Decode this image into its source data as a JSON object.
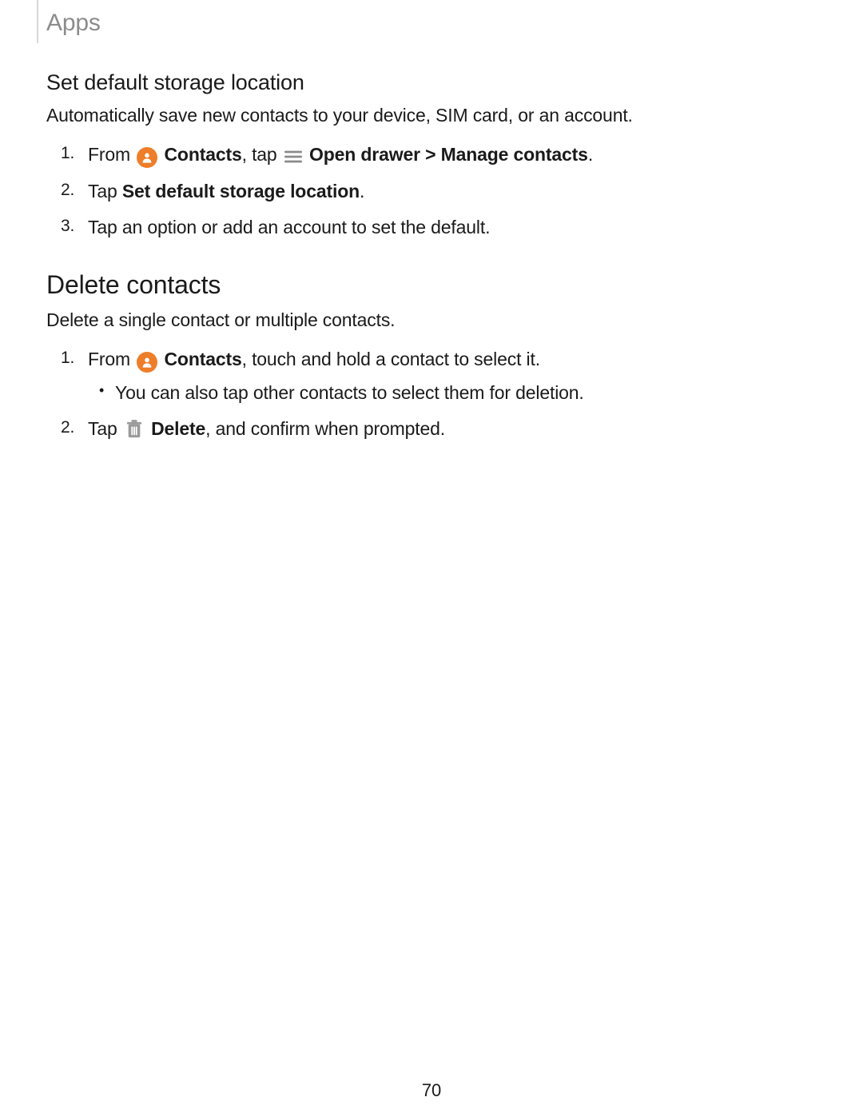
{
  "header": {
    "title": "Apps"
  },
  "page_number": "70",
  "labels": {
    "contacts": "Contacts",
    "open_drawer": "Open drawer",
    "manage_contacts": "Manage contacts",
    "set_default_storage_location": "Set default storage location",
    "delete": "Delete"
  },
  "section1": {
    "heading": "Set default storage location",
    "intro": "Automatically save new contacts to your device, SIM card, or an account.",
    "step1_from": "From ",
    "step1_tap": ", tap ",
    "step1_sep": " > ",
    "step1_end": ".",
    "step2_tap": "Tap ",
    "step2_end": ".",
    "step3": "Tap an option or add an account to set the default."
  },
  "section2": {
    "heading": "Delete contacts",
    "intro": "Delete a single contact or multiple contacts.",
    "step1_from": "From ",
    "step1_rest": ", touch and hold a contact to select it.",
    "step1_sub1": "You can also tap other contacts to select them for deletion.",
    "step2_tap": "Tap ",
    "step2_rest": ", and confirm when prompted."
  }
}
